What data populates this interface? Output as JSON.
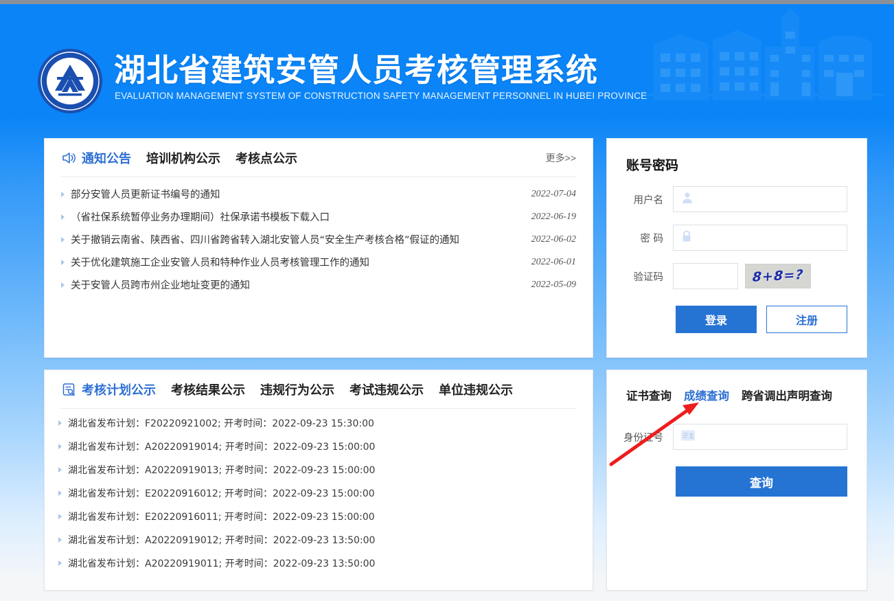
{
  "header": {
    "title": "湖北省建筑安管人员考核管理系统",
    "subtitle": "EVALUATION MANAGEMENT SYSTEM OF CONSTRUCTION SAFETY MANAGEMENT PERSONNEL IN HUBEI PROVINCE",
    "logo_icon": "hubei-emblem-icon",
    "skyline_icon": "city-skyline-icon",
    "brand_blue": "#0a84f7"
  },
  "notice_panel": {
    "lead_icon": "megaphone-icon",
    "tabs": [
      {
        "label": "通知公告",
        "active": true
      },
      {
        "label": "培训机构公示",
        "active": false
      },
      {
        "label": "考核点公示",
        "active": false
      }
    ],
    "more_label": "更多>>",
    "items": [
      {
        "title": "部分安管人员更新证书编号的通知",
        "date": "2022-07-04"
      },
      {
        "title": "（省社保系统暂停业务办理期间）社保承诺书模板下载入口",
        "date": "2022-06-19"
      },
      {
        "title": "关于撤销云南省、陕西省、四川省跨省转入湖北安管人员“安全生产考核合格”假证的通知",
        "date": "2022-06-02"
      },
      {
        "title": "关于优化建筑施工企业安管人员和特种作业人员考核管理工作的通知",
        "date": "2022-06-01"
      },
      {
        "title": "关于安管人员跨市州企业地址变更的通知",
        "date": "2022-05-09"
      }
    ]
  },
  "plan_panel": {
    "lead_icon": "document-search-icon",
    "tabs": [
      {
        "label": "考核计划公示",
        "active": true
      },
      {
        "label": "考核结果公示",
        "active": false
      },
      {
        "label": "违规行为公示",
        "active": false
      },
      {
        "label": "考试违规公示",
        "active": false
      },
      {
        "label": "单位违规公示",
        "active": false
      }
    ],
    "items": [
      {
        "text": "湖北省发布计划：F20220921002; 开考时间：2022-09-23 15:30:00"
      },
      {
        "text": "湖北省发布计划：A20220919014; 开考时间：2022-09-23 15:00:00"
      },
      {
        "text": "湖北省发布计划：A20220919013; 开考时间：2022-09-23 15:00:00"
      },
      {
        "text": "湖北省发布计划：E20220916012; 开考时间：2022-09-23 15:00:00"
      },
      {
        "text": "湖北省发布计划：E20220916011; 开考时间：2022-09-23 15:00:00"
      },
      {
        "text": "湖北省发布计划：A20220919012; 开考时间：2022-09-23 13:50:00"
      },
      {
        "text": "湖北省发布计划：A20220919011; 开考时间：2022-09-23 13:50:00"
      }
    ]
  },
  "login_panel": {
    "title": "账号密码",
    "username": {
      "label": "用户名",
      "value": "",
      "placeholder": "",
      "icon": "user-icon"
    },
    "password": {
      "label": "密 码",
      "value": "",
      "placeholder": "",
      "icon": "lock-icon"
    },
    "captcha": {
      "label": "验证码",
      "value": "",
      "image_text": "8+8=?"
    },
    "login_button": "登录",
    "register_button": "注册",
    "primary_color": "#2574d4"
  },
  "query_panel": {
    "tabs": [
      {
        "label": "证书查询",
        "active": false
      },
      {
        "label": "成绩查询",
        "active": true
      },
      {
        "label": "跨省调出声明查询",
        "active": false
      }
    ],
    "id_field": {
      "label": "身份证号",
      "value": "",
      "placeholder": "",
      "icon": "id-card-icon"
    },
    "query_button": "查询"
  },
  "annotation": {
    "arrow_icon": "red-arrow-icon",
    "arrow_color": "#ee1c1c",
    "points_to": "成绩查询"
  }
}
